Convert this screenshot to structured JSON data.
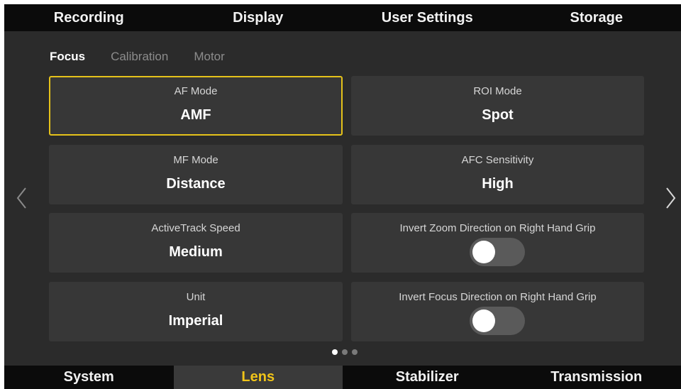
{
  "top_tabs": [
    "Recording",
    "Display",
    "User Settings",
    "Storage"
  ],
  "sub_tabs": {
    "items": [
      "Focus",
      "Calibration",
      "Motor"
    ],
    "active": "Focus"
  },
  "settings": {
    "af_mode": {
      "label": "AF Mode",
      "value": "AMF",
      "selected": true
    },
    "roi_mode": {
      "label": "ROI Mode",
      "value": "Spot"
    },
    "mf_mode": {
      "label": "MF Mode",
      "value": "Distance"
    },
    "afc_sensitivity": {
      "label": "AFC Sensitivity",
      "value": "High"
    },
    "activetrack_speed": {
      "label": "ActiveTrack Speed",
      "value": "Medium"
    },
    "invert_zoom": {
      "label": "Invert Zoom Direction on Right Hand Grip",
      "enabled": false
    },
    "unit": {
      "label": "Unit",
      "value": "Imperial"
    },
    "invert_focus": {
      "label": "Invert Focus Direction on Right Hand Grip",
      "enabled": false
    }
  },
  "pagination": {
    "pages": 3,
    "current": 1
  },
  "bottom_tabs": {
    "items": [
      "System",
      "Lens",
      "Stabilizer",
      "Transmission"
    ],
    "active": "Lens"
  },
  "colors": {
    "accent": "#f0c419",
    "selected_border": "#e5c21a",
    "background": "#2b2b2b",
    "card": "#373737",
    "bar": "#0b0b0b"
  },
  "icons": {
    "prev": "chevron-left-icon",
    "next": "chevron-right-icon"
  }
}
